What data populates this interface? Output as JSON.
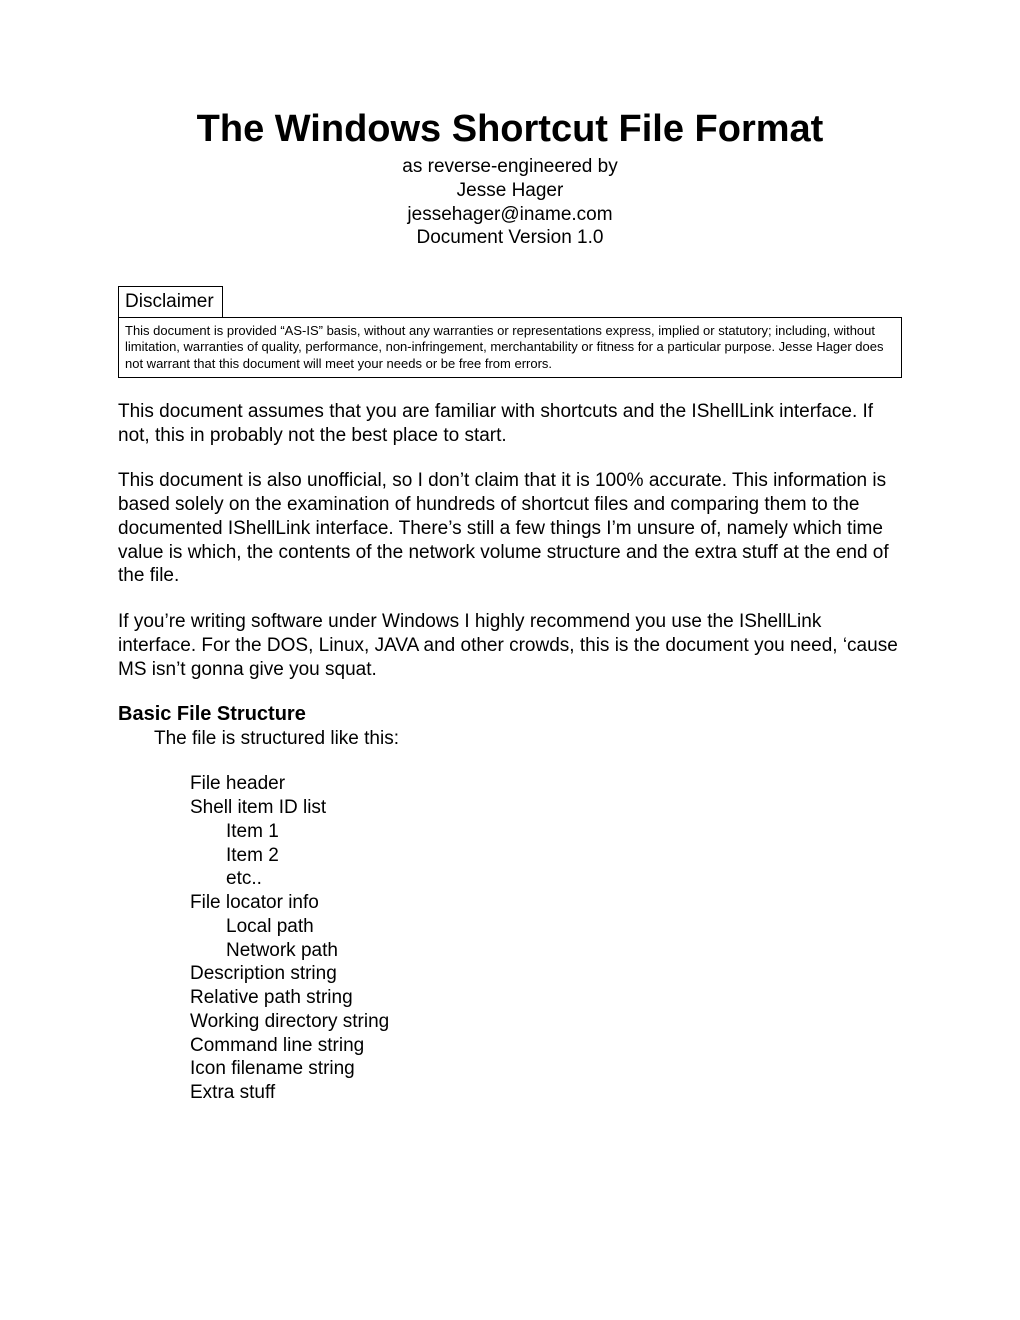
{
  "title": "The Windows Shortcut File Format",
  "subtitle": {
    "line1": "as reverse-engineered by",
    "line2": "Jesse Hager",
    "line3": "jessehager@iname.com",
    "line4": "Document Version 1.0"
  },
  "disclaimer": {
    "label": "Disclaimer",
    "body": "This document is provided “AS-IS” basis, without any warranties or representations express, implied or statutory; including, without limitation, warranties of quality, performance, non-infringement, merchantability or fitness for a particular purpose.  Jesse Hager does not warrant that this document will meet your needs or be free from errors."
  },
  "paragraphs": {
    "p1": "This document assumes that you are familiar with shortcuts and the IShellLink interface.  If not, this in probably not the best place to start.",
    "p2": "This document is also unofficial, so I don’t claim that it is 100% accurate.  This information is based solely on the examination of hundreds of shortcut files and comparing them to the documented IShellLink interface.  There’s still a few things I’m unsure of, namely which time value is which, the contents of the network volume structure and the extra stuff at the end of the file.",
    "p3": "If you’re writing software under Windows I highly recommend you use the IShellLink interface.  For the DOS, Linux, JAVA and other crowds, this is the document you need, ‘cause MS isn’t gonna give you squat."
  },
  "section": {
    "heading": "Basic File Structure",
    "intro": "The file is structured like this:",
    "items": {
      "i0": "File header",
      "i1": "Shell item ID list",
      "i1a": "Item 1",
      "i1b": "Item 2",
      "i1c": "etc..",
      "i2": "File locator info",
      "i2a": "Local path",
      "i2b": "Network path",
      "i3": "Description string",
      "i4": "Relative path string",
      "i5": "Working directory string",
      "i6": "Command line string",
      "i7": "Icon filename string",
      "i8": "Extra stuff"
    }
  }
}
